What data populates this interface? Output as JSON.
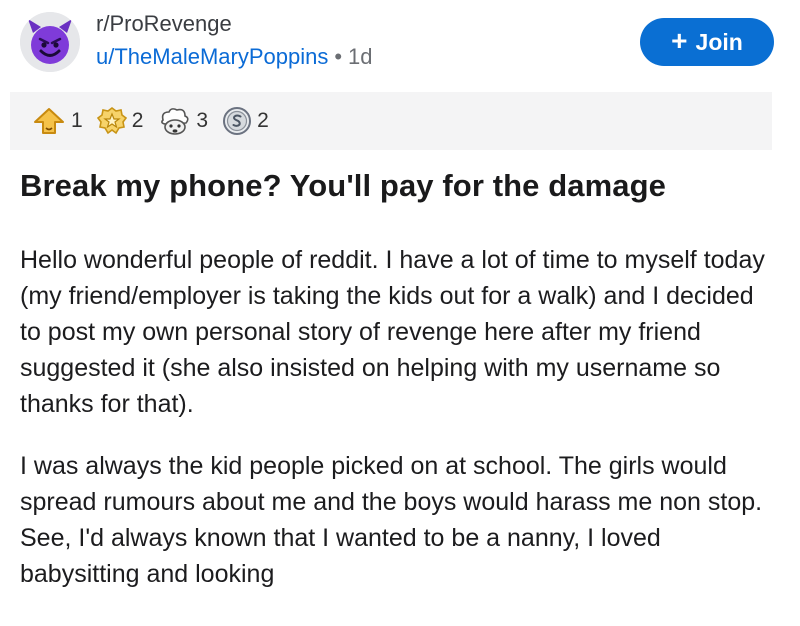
{
  "post": {
    "subreddit": "r/ProRevenge",
    "username": "u/TheMaleMaryPoppins",
    "separator": "•",
    "age": "1d",
    "join_label": "Join",
    "title": "Break my phone? You'll pay for the damage",
    "awards": [
      {
        "icon": "upvote-award-icon",
        "count": "1"
      },
      {
        "icon": "star-badge-award-icon",
        "count": "2"
      },
      {
        "icon": "mind-blown-award-icon",
        "count": "3"
      },
      {
        "icon": "silver-coin-award-icon",
        "count": "2"
      }
    ],
    "paragraphs": [
      "Hello wonderful people of reddit. I have a lot of time to myself today (my friend/employer is taking the kids out for a walk) and I decided to post my own personal story of revenge here after my friend suggested it (she also insisted on helping with my username so thanks for that).",
      "I was always the kid people picked on at school. The girls would spread rumours about me and the boys would harass me non stop. See, I'd always known that I wanted to be a nanny, I loved babysitting and looking"
    ]
  },
  "colors": {
    "join_button": "#0a6fd3",
    "username": "#0b6bd6",
    "award_bar": "#f4f4f5",
    "avatar_face": "#7f3bd9"
  }
}
